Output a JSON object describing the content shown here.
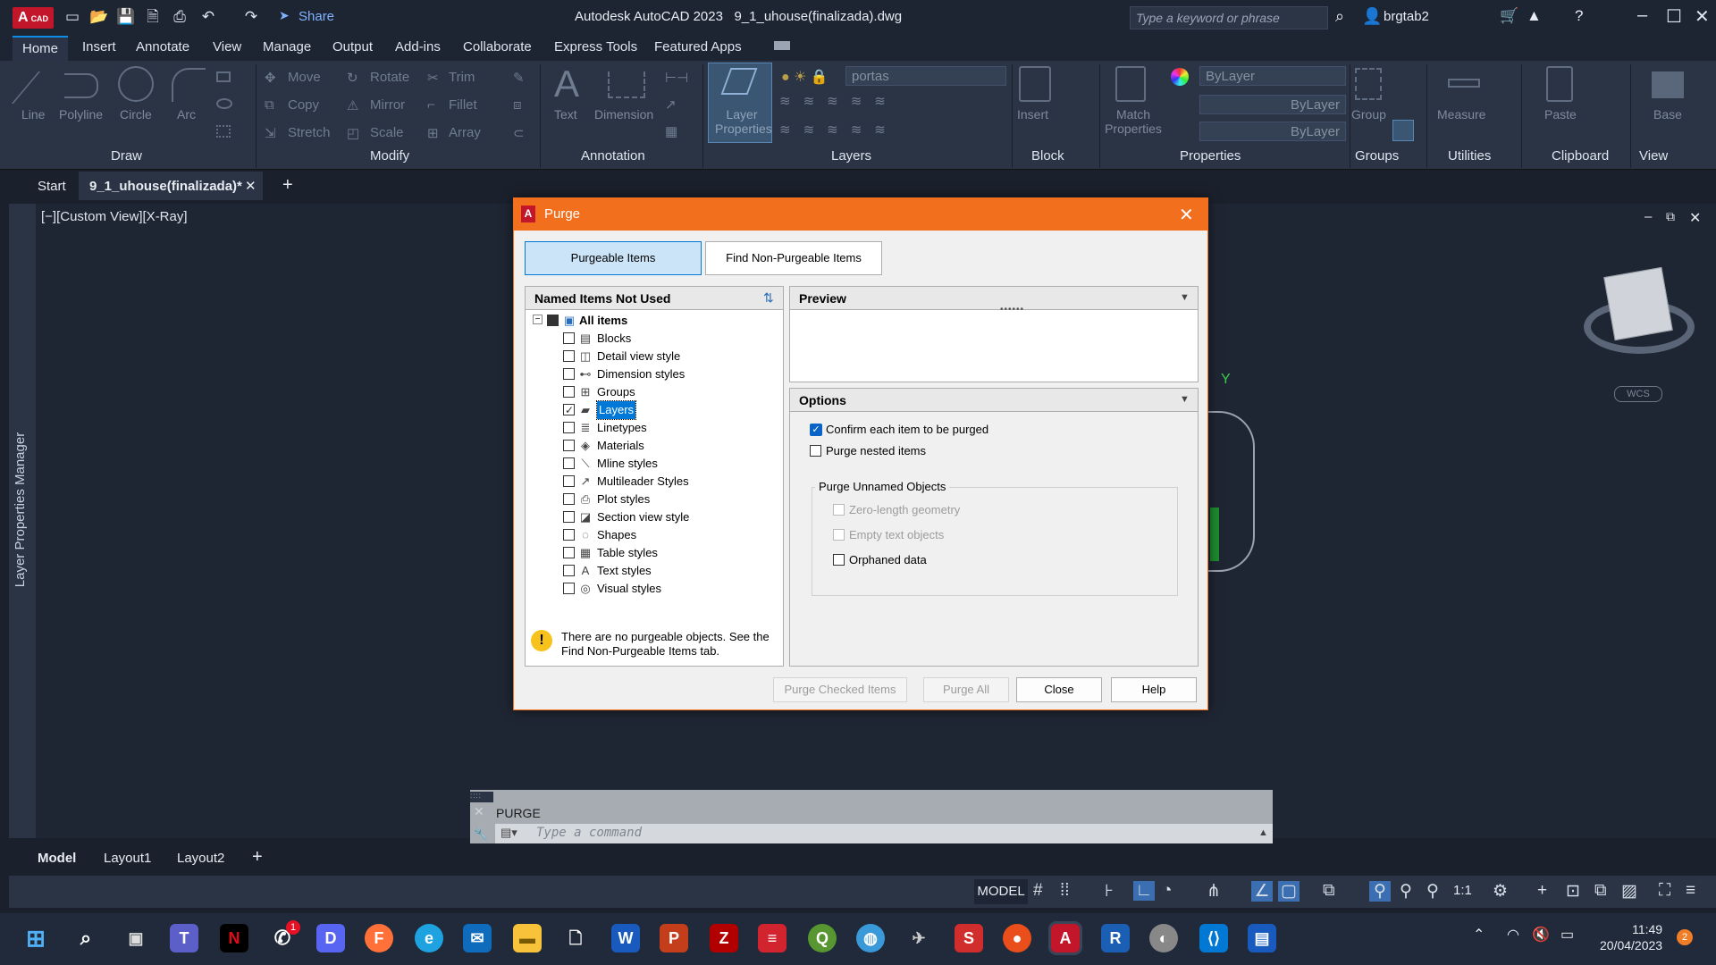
{
  "app": {
    "logo": "A",
    "logo_sub": "CAD",
    "window_title": "Autodesk AutoCAD 2023",
    "file_name": "9_1_uhouse(finalizada).dwg",
    "share": "Share",
    "search_placeholder": "Type a keyword or phrase",
    "user": "brgtab2"
  },
  "ribbon_tabs": [
    "Home",
    "Insert",
    "Annotate",
    "View",
    "Manage",
    "Output",
    "Add-ins",
    "Collaborate",
    "Express Tools",
    "Featured Apps"
  ],
  "ribbon": {
    "draw": {
      "line": "Line",
      "polyline": "Polyline",
      "circle": "Circle",
      "arc": "Arc",
      "panel": "Draw"
    },
    "modify": {
      "move": "Move",
      "rotate": "Rotate",
      "trim": "Trim",
      "copy": "Copy",
      "mirror": "Mirror",
      "fillet": "Fillet",
      "stretch": "Stretch",
      "scale": "Scale",
      "array": "Array",
      "panel": "Modify"
    },
    "annotation": {
      "text": "Text",
      "dimension": "Dimension",
      "panel": "Annotation"
    },
    "layers": {
      "layer_properties": "Layer Properties",
      "current_layer": "portas",
      "panel": "Layers"
    },
    "block": {
      "insert": "Insert",
      "panel": "Block"
    },
    "properties": {
      "match": "Match Properties",
      "color": "ByLayer",
      "linetype": "ByLayer",
      "lineweight": "ByLayer",
      "panel": "Properties"
    },
    "groups": {
      "group": "Group",
      "panel": "Groups"
    },
    "utilities": {
      "measure": "Measure",
      "panel": "Utilities"
    },
    "clipboard": {
      "paste": "Paste",
      "panel": "Clipboard"
    },
    "view": {
      "base": "Base",
      "panel": "View"
    }
  },
  "file_tabs": {
    "start": "Start",
    "active": "9_1_uhouse(finalizada)*"
  },
  "viewport": {
    "label": "[−][Custom View][X-Ray]",
    "palette": "Layer Properties Manager",
    "wcs": "WCS"
  },
  "dialog": {
    "title": "Purge",
    "tabs": [
      "Purgeable Items",
      "Find Non-Purgeable Items"
    ],
    "left_header": "Named Items Not Used",
    "root": "All items",
    "items": [
      {
        "label": "Blocks",
        "checked": false
      },
      {
        "label": "Detail view style",
        "checked": false
      },
      {
        "label": "Dimension styles",
        "checked": false
      },
      {
        "label": "Groups",
        "checked": false
      },
      {
        "label": "Layers",
        "checked": true,
        "selected": true
      },
      {
        "label": "Linetypes",
        "checked": false
      },
      {
        "label": "Materials",
        "checked": false
      },
      {
        "label": "Mline styles",
        "checked": false
      },
      {
        "label": "Multileader Styles",
        "checked": false
      },
      {
        "label": "Plot styles",
        "checked": false
      },
      {
        "label": "Section view style",
        "checked": false
      },
      {
        "label": "Shapes",
        "checked": false
      },
      {
        "label": "Table styles",
        "checked": false
      },
      {
        "label": "Text styles",
        "checked": false
      },
      {
        "label": "Visual styles",
        "checked": false
      }
    ],
    "warning": "There are no purgeable objects. See the Find Non-Purgeable Items tab.",
    "preview_header": "Preview",
    "options_header": "Options",
    "opt_confirm": "Confirm each item to be purged",
    "opt_nested": "Purge nested items",
    "group_label": "Purge Unnamed Objects",
    "opt_zero": "Zero-length geometry",
    "opt_empty": "Empty text objects",
    "opt_orphaned": "Orphaned data",
    "btn_purge_checked": "Purge Checked Items",
    "btn_purge_all": "Purge All",
    "btn_close": "Close",
    "btn_help": "Help"
  },
  "command": {
    "history": "PURGE",
    "placeholder": "Type a command"
  },
  "layout_tabs": [
    "Model",
    "Layout1",
    "Layout2"
  ],
  "status": {
    "model": "MODEL",
    "scale": "1:1"
  },
  "taskbar": {
    "time": "11:49",
    "date": "20/04/2023",
    "notif": "2",
    "whatsapp_badge": "1"
  },
  "colors": {
    "accent": "#f26f1e",
    "selection": "#0078d7",
    "ribbon": "#2a3445",
    "autocad_red": "#c4162a"
  }
}
